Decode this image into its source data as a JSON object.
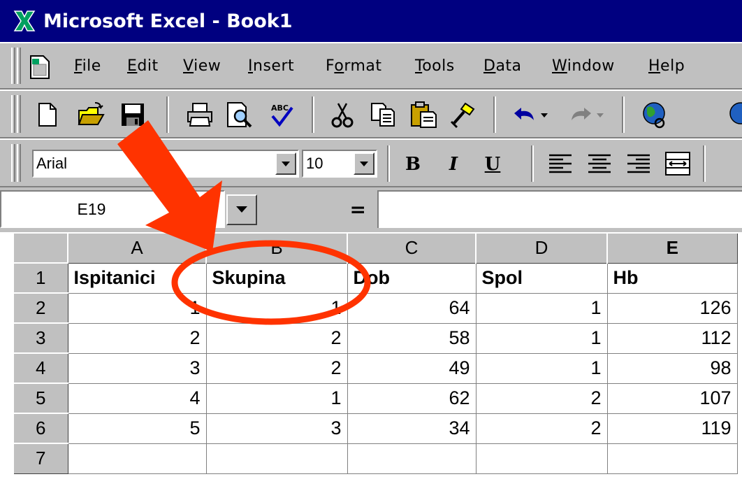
{
  "window": {
    "title": "Microsoft Excel - Book1"
  },
  "menu": [
    {
      "key": "F",
      "rest": "ile"
    },
    {
      "key": "E",
      "rest": "dit"
    },
    {
      "key": "V",
      "rest": "iew"
    },
    {
      "key": "I",
      "rest": "nsert"
    },
    {
      "pre": "F",
      "key": "o",
      "rest": "rmat"
    },
    {
      "key": "T",
      "rest": "ools"
    },
    {
      "key": "D",
      "rest": "ata"
    },
    {
      "key": "W",
      "rest": "indow"
    },
    {
      "key": "H",
      "rest": "elp"
    }
  ],
  "format_toolbar": {
    "font": "Arial",
    "size": "10",
    "bold": "B",
    "italic": "I",
    "underline": "U"
  },
  "formula_bar": {
    "name_box": "E19",
    "equals": "=",
    "formula": ""
  },
  "sheet": {
    "columns": [
      "A",
      "B",
      "C",
      "D",
      "E"
    ],
    "active_column": "E",
    "rows": [
      {
        "num": "1",
        "cells": [
          "Ispitanici",
          "Skupina",
          "Dob",
          "Spol",
          "Hb"
        ]
      },
      {
        "num": "2",
        "cells": [
          "1",
          "1",
          "64",
          "1",
          "126"
        ]
      },
      {
        "num": "3",
        "cells": [
          "2",
          "2",
          "58",
          "1",
          "112"
        ]
      },
      {
        "num": "4",
        "cells": [
          "3",
          "2",
          "49",
          "1",
          "98"
        ]
      },
      {
        "num": "5",
        "cells": [
          "4",
          "1",
          "62",
          "2",
          "107"
        ]
      },
      {
        "num": "6",
        "cells": [
          "5",
          "3",
          "34",
          "2",
          "119"
        ]
      },
      {
        "num": "7",
        "cells": [
          "",
          "",
          "",
          "",
          ""
        ]
      }
    ]
  },
  "colors": {
    "titlebar": "#000080",
    "chrome": "#c0c0c0",
    "annotation": "#ff3300"
  }
}
